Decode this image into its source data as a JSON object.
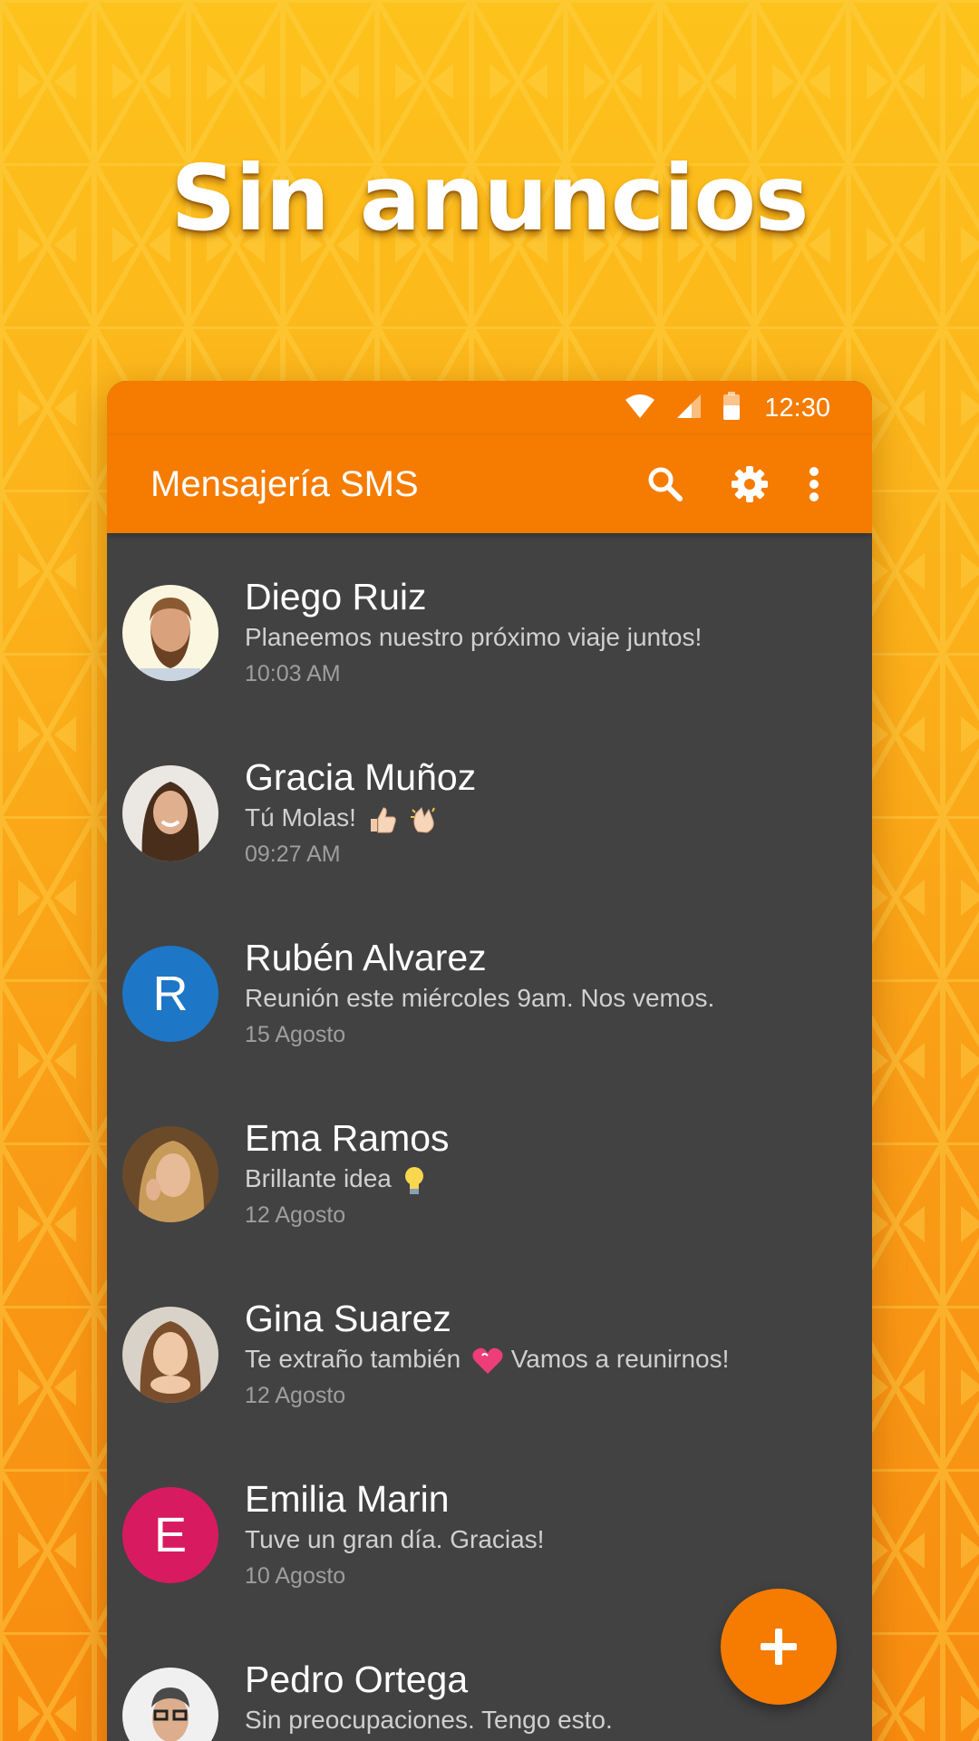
{
  "headline": "Sin anuncios",
  "colors": {
    "accent": "#f57c00",
    "list_background": "#424242",
    "avatar_blue": "#1e76c6",
    "avatar_pink": "#d81b60"
  },
  "status_bar": {
    "time": "12:30",
    "icons": [
      "wifi-icon",
      "signal-icon",
      "battery-icon"
    ]
  },
  "app_bar": {
    "title": "Mensajería SMS",
    "actions": [
      "search-icon",
      "settings-icon",
      "more-vert-icon"
    ]
  },
  "conversations": [
    {
      "name": "Diego Ruiz",
      "preview": "Planeemos nuestro próximo viaje juntos!",
      "time": "10:03 AM",
      "avatar": "photo"
    },
    {
      "name": "Gracia Muñoz",
      "preview": "Tú Molas!",
      "preview_emoji": [
        "thumbs-up-emoji",
        "clapping-hands-emoji"
      ],
      "time": "09:27 AM",
      "avatar": "photo"
    },
    {
      "name": "Rubén Alvarez",
      "preview": "Reunión este miércoles 9am. Nos vemos.",
      "time": "15 Agosto",
      "avatar": "letter",
      "letter": "R",
      "avatar_color": "#1e76c6"
    },
    {
      "name": "Ema Ramos",
      "preview": "Brillante idea",
      "preview_emoji": [
        "light-bulb-emoji"
      ],
      "time": "12 Agosto",
      "avatar": "photo"
    },
    {
      "name": "Gina Suarez",
      "preview_before": "Te extraño también",
      "preview_after": "Vamos a reunirnos!",
      "preview_emoji": [
        "heart-emoji"
      ],
      "time": "12 Agosto",
      "avatar": "photo"
    },
    {
      "name": "Emilia Marin",
      "preview": "Tuve un gran día. Gracias!",
      "time": "10 Agosto",
      "avatar": "letter",
      "letter": "E",
      "avatar_color": "#d81b60"
    },
    {
      "name": "Pedro Ortega",
      "preview": "Sin preocupaciones. Tengo esto.",
      "time": "",
      "avatar": "photo"
    }
  ],
  "fab": {
    "icon": "plus-icon"
  }
}
